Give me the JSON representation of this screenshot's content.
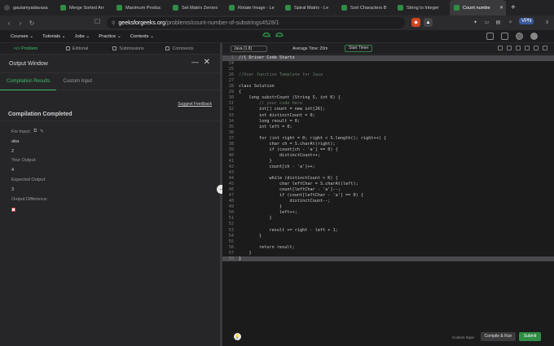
{
  "browser": {
    "tabs": [
      {
        "label": "gautamyadavasa",
        "favicon": "user-avatar",
        "active": false
      },
      {
        "label": "Merge Sorted Arr",
        "favicon": "gfg-logo",
        "active": false
      },
      {
        "label": "Maximum Produc",
        "favicon": "gfg-logo",
        "active": false
      },
      {
        "label": "Set Matrix Zeroes",
        "favicon": "gfg-logo",
        "active": false
      },
      {
        "label": "Rotate Image - Le",
        "favicon": "gfg-logo",
        "active": false
      },
      {
        "label": "Spiral Matrix - Le",
        "favicon": "gfg-logo",
        "active": false
      },
      {
        "label": "Sort Characters B",
        "favicon": "gfg-logo",
        "active": false
      },
      {
        "label": "String to Integer",
        "favicon": "gfg-logo",
        "active": false
      },
      {
        "label": "Count numbe",
        "favicon": "gfg-logo",
        "active": true
      }
    ],
    "url_host": "geeksforgeeks.org",
    "url_path": "/problems/count-number-of-substrings4528/1",
    "vpn_label": "VPN"
  },
  "site_nav": {
    "items": [
      "Courses ⌄",
      "Tutorials ⌄",
      "Jobs ⌄",
      "Practice ⌄",
      "Contests ⌄"
    ]
  },
  "left_tabs": [
    "</> Problem",
    "Editorial",
    "Submissions",
    "Comments"
  ],
  "output_window": {
    "title": "Output Window",
    "tabs": [
      "Compilation Results",
      "Custom Input"
    ],
    "feedback_link": "Suggest Feedback",
    "status": "Compilation Completed",
    "for_input_label": "For Input:",
    "input_values": [
      "aba",
      "2"
    ],
    "your_output_label": "Your Output:",
    "your_output": "4",
    "expected_output_label": "Expected Output:",
    "expected_output": "3",
    "output_difference_label": "Output Difference:"
  },
  "editor": {
    "language": "Java (1.8)",
    "average_time": "Average Time: 20m",
    "timer_label": "Start Timer",
    "lines": [
      {
        "n": "1",
        "text": "//{ Driver Code Starts",
        "cls": "hl"
      },
      {
        "n": "24",
        "text": "",
        "cls": ""
      },
      {
        "n": "25",
        "text": "",
        "cls": ""
      },
      {
        "n": "26",
        "text": "//User function Template for Java",
        "cls": "cmt"
      },
      {
        "n": "27",
        "text": "",
        "cls": ""
      },
      {
        "n": "28",
        "text": "class Solution",
        "cls": ""
      },
      {
        "n": "29",
        "text": "{",
        "cls": ""
      },
      {
        "n": "30",
        "text": "    long substrCount (String S, int K) {",
        "cls": ""
      },
      {
        "n": "31",
        "text": "        // your code here",
        "cls": "cmt"
      },
      {
        "n": "32",
        "text": "        int[] count = new int[26];",
        "cls": ""
      },
      {
        "n": "33",
        "text": "        int distinctCount = 0;",
        "cls": ""
      },
      {
        "n": "34",
        "text": "        long result = 0;",
        "cls": ""
      },
      {
        "n": "35",
        "text": "        int left = 0;",
        "cls": ""
      },
      {
        "n": "36",
        "text": "",
        "cls": ""
      },
      {
        "n": "37",
        "text": "        for (int right = 0; right < S.length(); right++) {",
        "cls": ""
      },
      {
        "n": "38",
        "text": "            char ch = S.charAt(right);",
        "cls": ""
      },
      {
        "n": "39",
        "text": "            if (count[ch - 'a'] == 0) {",
        "cls": ""
      },
      {
        "n": "40",
        "text": "                distinctCount++;",
        "cls": ""
      },
      {
        "n": "41",
        "text": "            }",
        "cls": ""
      },
      {
        "n": "42",
        "text": "            count[ch - 'a']++;",
        "cls": ""
      },
      {
        "n": "43",
        "text": "",
        "cls": ""
      },
      {
        "n": "44",
        "text": "            while (distinctCount > K) {",
        "cls": ""
      },
      {
        "n": "45",
        "text": "                char leftChar = S.charAt(left);",
        "cls": ""
      },
      {
        "n": "46",
        "text": "                count[leftChar - 'a']--;",
        "cls": ""
      },
      {
        "n": "47",
        "text": "                if (count[leftChar - 'a'] == 0) {",
        "cls": ""
      },
      {
        "n": "48",
        "text": "                    distinctCount--;",
        "cls": ""
      },
      {
        "n": "49",
        "text": "                }",
        "cls": ""
      },
      {
        "n": "50",
        "text": "                left++;",
        "cls": ""
      },
      {
        "n": "51",
        "text": "            }",
        "cls": ""
      },
      {
        "n": "52",
        "text": "",
        "cls": ""
      },
      {
        "n": "53",
        "text": "            result += right - left + 1;",
        "cls": ""
      },
      {
        "n": "54",
        "text": "        }",
        "cls": ""
      },
      {
        "n": "55",
        "text": "",
        "cls": ""
      },
      {
        "n": "56",
        "text": "        return result;",
        "cls": ""
      },
      {
        "n": "57",
        "text": "    }",
        "cls": ""
      },
      {
        "n": "58",
        "text": "}",
        "cls": "hl"
      }
    ],
    "custom_input_label": "Custom Input",
    "compile_run_label": "Compile & Run",
    "submit_label": "Submit"
  },
  "colors": {
    "accent_green": "#2f8d46",
    "active_tab_green": "#3fbf6a"
  }
}
